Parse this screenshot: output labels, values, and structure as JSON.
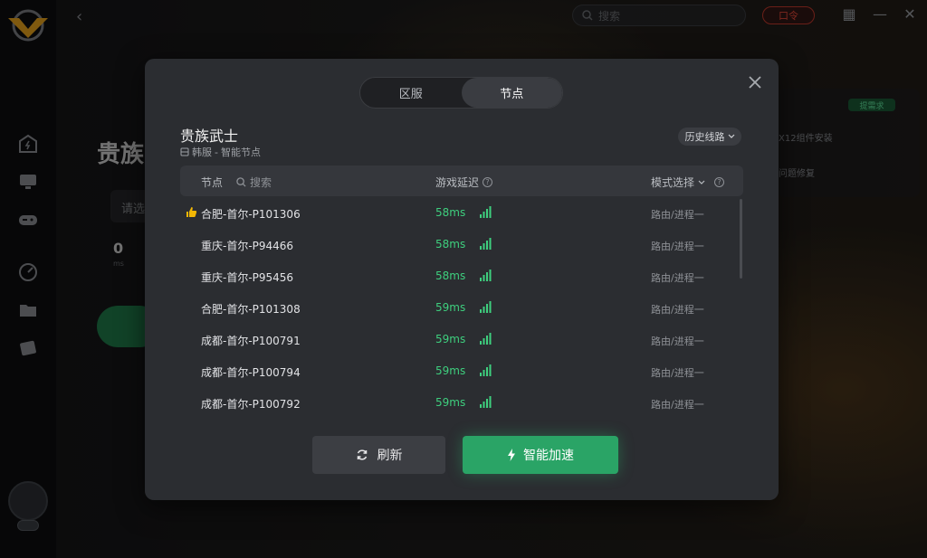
{
  "app": {
    "search_placeholder": "搜索",
    "vip_label": "口令",
    "bg_title": "贵族",
    "bg_select": "请选",
    "bg_ping": "0",
    "bg_ping_unit": "ms",
    "bg_tag": "提需求",
    "bg_line1": "X12组件安装",
    "bg_line2": "问题修复"
  },
  "modal": {
    "tabs": [
      {
        "label": "区服",
        "active": false
      },
      {
        "label": "节点",
        "active": true
      }
    ],
    "game_title": "贵族武士",
    "region": "韩服",
    "separator": "-",
    "node_type": "智能节点",
    "history_button": "历史线路",
    "table": {
      "col_node": "节点",
      "search_placeholder": "搜索",
      "col_latency": "游戏延迟",
      "col_mode": "模式选择"
    },
    "rows": [
      {
        "name": "合肥-首尔-P101306",
        "ping": "58ms",
        "mode": "路由/进程一",
        "recommended": true
      },
      {
        "name": "重庆-首尔-P94466",
        "ping": "58ms",
        "mode": "路由/进程一",
        "recommended": false
      },
      {
        "name": "重庆-首尔-P95456",
        "ping": "58ms",
        "mode": "路由/进程一",
        "recommended": false
      },
      {
        "name": "合肥-首尔-P101308",
        "ping": "59ms",
        "mode": "路由/进程一",
        "recommended": false
      },
      {
        "name": "成都-首尔-P100791",
        "ping": "59ms",
        "mode": "路由/进程一",
        "recommended": false
      },
      {
        "name": "成都-首尔-P100794",
        "ping": "59ms",
        "mode": "路由/进程一",
        "recommended": false
      },
      {
        "name": "成都-首尔-P100792",
        "ping": "59ms",
        "mode": "路由/进程一",
        "recommended": false
      }
    ],
    "refresh_button": "刷新",
    "boost_button": "智能加速"
  },
  "colors": {
    "accent_green": "#2aa466",
    "ping_green": "#3ecf7e",
    "thumb_yellow": "#f2b705",
    "modal_bg": "#2b2d31"
  }
}
